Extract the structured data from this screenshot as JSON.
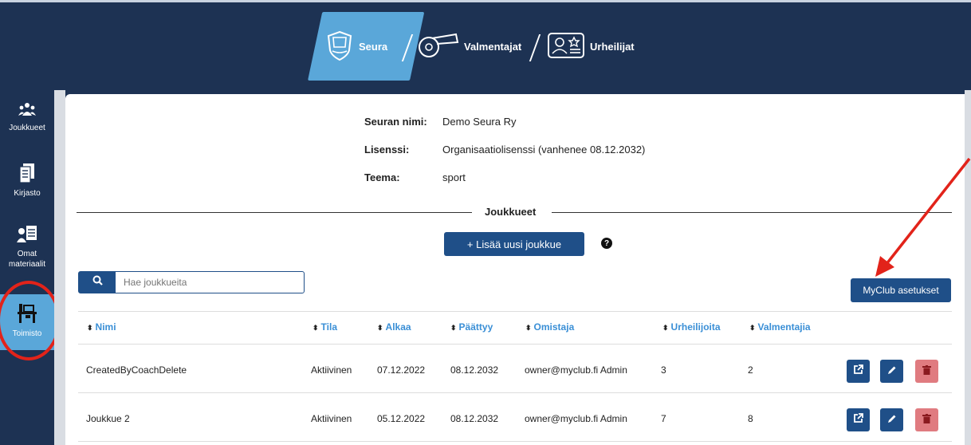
{
  "topnav": {
    "tabs": [
      {
        "label": "Seura",
        "active": true,
        "icon": "shield-icon"
      },
      {
        "label": "Valmentajat",
        "active": false,
        "icon": "whistle-icon"
      },
      {
        "label": "Urheilijat",
        "active": false,
        "icon": "athlete-card-icon"
      }
    ]
  },
  "sidebar": {
    "items": [
      {
        "label": "Joukkueet",
        "icon": "teams-icon",
        "active": false
      },
      {
        "label": "Kirjasto",
        "icon": "library-icon",
        "active": false
      },
      {
        "label": "Omat materiaalit",
        "icon": "materials-icon",
        "active": false
      },
      {
        "label": "Toimisto",
        "icon": "office-icon",
        "active": true
      }
    ]
  },
  "club_info": {
    "name_label": "Seuran nimi:",
    "name_value": "Demo Seura Ry",
    "license_label": "Lisenssi:",
    "license_value": "Organisaatiolisenssi (vanhenee 08.12.2032)",
    "theme_label": "Teema:",
    "theme_value": "sport"
  },
  "teams_section": {
    "title": "Joukkueet",
    "add_button": "+ Lisää uusi joukkue",
    "help": "?",
    "myclub_button": "MyClub asetukset",
    "search_placeholder": "Hae joukkueita"
  },
  "table": {
    "headers": [
      "Nimi",
      "Tila",
      "Alkaa",
      "Päättyy",
      "Omistaja",
      "Urheilijoita",
      "Valmentajia"
    ],
    "rows": [
      {
        "name": "CreatedByCoachDelete",
        "status": "Aktiivinen",
        "start": "07.12.2022",
        "end": "08.12.2032",
        "owner": "owner@myclub.fi Admin",
        "athletes": "3",
        "coaches": "2"
      },
      {
        "name": "Joukkue 2",
        "status": "Aktiivinen",
        "start": "05.12.2022",
        "end": "08.12.2032",
        "owner": "owner@myclub.fi Admin",
        "athletes": "7",
        "coaches": "8"
      }
    ]
  },
  "colors": {
    "navy": "#1d3253",
    "accent": "#5aa7d9",
    "primary_button": "#1f4f88",
    "delete_button": "#e07b80",
    "annotation_red": "#e2231a"
  }
}
